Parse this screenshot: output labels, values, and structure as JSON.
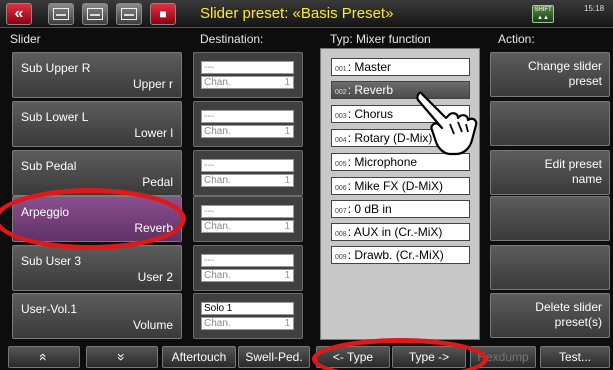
{
  "title": "Slider preset: «Basis Preset»",
  "clock": "15:18",
  "shift_label": "SHIFT",
  "headers": {
    "slider": "Slider",
    "destination": "Destination:",
    "type": "Typ:  Mixer function",
    "action": "Action:"
  },
  "sliders": [
    {
      "name": "Sub Upper R",
      "sub": "Upper r"
    },
    {
      "name": "Sub Lower L",
      "sub": "Lower l"
    },
    {
      "name": "Sub Pedal",
      "sub": "Pedal"
    },
    {
      "name": "Arpeggio",
      "sub": "Reverb"
    },
    {
      "name": "Sub User 3",
      "sub": "User 2"
    },
    {
      "name": "User-Vol.1",
      "sub": "Volume"
    }
  ],
  "destinations": [
    {
      "line1": "---",
      "line2": "Chan.",
      "chan": "1"
    },
    {
      "line1": "---",
      "line2": "Chan.",
      "chan": "1"
    },
    {
      "line1": "---",
      "line2": "Chan.",
      "chan": "1"
    },
    {
      "line1": "---",
      "line2": "Chan.",
      "chan": "1"
    },
    {
      "line1": "---",
      "line2": "Chan.",
      "chan": "1"
    },
    {
      "line1": "Solo 1",
      "line2": "Chan.",
      "chan": "1"
    }
  ],
  "types": [
    {
      "num": "001",
      "label": "Master"
    },
    {
      "num": "002",
      "label": "Reverb"
    },
    {
      "num": "003",
      "label": "Chorus"
    },
    {
      "num": "004",
      "label": "Rotary (D-Mix)"
    },
    {
      "num": "005",
      "label": "Microphone"
    },
    {
      "num": "006",
      "label": "Mike FX (D-MiX)"
    },
    {
      "num": "007",
      "label": "0 dB in"
    },
    {
      "num": "008",
      "label": "AUX in (Cr.-MiX)"
    },
    {
      "num": "009",
      "label": "Drawb. (Cr.-MiX)"
    }
  ],
  "selected_type": "002",
  "actions": [
    {
      "line1": "Change slider",
      "line2": "preset"
    },
    {
      "line1": "",
      "line2": ""
    },
    {
      "line1": "Edit preset",
      "line2": "name"
    },
    {
      "line1": "",
      "line2": ""
    },
    {
      "line1": "",
      "line2": ""
    },
    {
      "line1": "Delete slider",
      "line2": "preset(s)"
    }
  ],
  "bottom": {
    "up": "«",
    "down": "»",
    "aftertouch": "Aftertouch",
    "swell": "Swell-Ped.",
    "type_prev": "<- Type",
    "type_next": "Type ->",
    "hexdump": "Hexdump",
    "test": "Test..."
  },
  "colors": {
    "title": "#ffea2d",
    "highlight_ring": "#e01818",
    "active_slider": "#7a4480"
  }
}
